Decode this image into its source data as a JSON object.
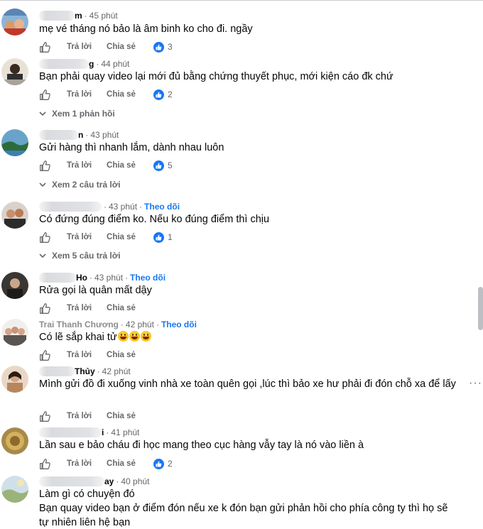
{
  "labels": {
    "reply": "Trả lời",
    "share": "Chia sẻ",
    "follow": "Theo dõi"
  },
  "comments": [
    {
      "name_visible": "m",
      "time": "45 phút",
      "text": "mẹ vé tháng nó bảo là âm binh ko cho đi. ngầy",
      "reactions": "3"
    },
    {
      "name_visible": "g",
      "time": "44 phút",
      "text": "Bạn phải quay video lại mới đủ bằng chứng thuyết phục, mới kiện cáo đk chứ",
      "reactions": "2",
      "replies": "Xem 1 phản hồi"
    },
    {
      "name_visible": "n",
      "time": "43 phút",
      "text": "Gửi hàng thì nhanh lắm, dành nhau luôn",
      "reactions": "5",
      "replies": "Xem 2 câu trả lời"
    },
    {
      "name_visible": "",
      "time": "43 phút",
      "text": "Có đứng đúng điểm ko. Nếu ko đúng điểm thì chịu",
      "reactions": "1",
      "replies": "Xem 5 câu trả lời"
    },
    {
      "name_visible": "Ho",
      "time": "43 phút",
      "text": "Rửa gọi là quân mất dậy"
    },
    {
      "name_visible": "Trai Thanh Chương",
      "time": "42 phút",
      "text": "Có lẽ sắp khai tử"
    },
    {
      "name_visible": "Thủy",
      "time": "42 phút",
      "text": "Mình gửi đồ đi xuống vinh nhà xe toàn quên gọi ,lúc thì bảo xe hư phải đi đón chỗ xa để lấy"
    },
    {
      "name_visible": "i",
      "time": "41 phút",
      "text": "Lần sau e bảo cháu đi học mang theo cục hàng vẫy tay là nó vào liền à",
      "reactions": "2"
    },
    {
      "name_visible": "ay",
      "time": "40 phút",
      "text": "Làm gì có chuyện đó\nBạn quay video bạn ở điểm đón nếu xe k đón bạn gửi phản hồi cho phía công ty thì họ sẽ tự nhiên liên hệ bạn"
    }
  ],
  "more_glyph": "···",
  "separator": "·"
}
